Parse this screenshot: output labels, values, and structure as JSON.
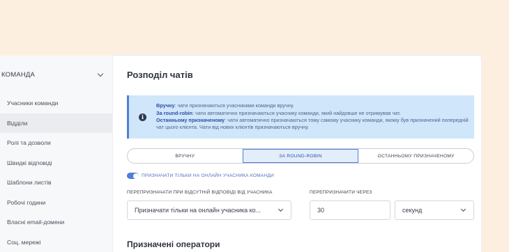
{
  "sidebar": {
    "header": "КОМАНДА",
    "items": [
      {
        "label": "Учасники команди",
        "active": false
      },
      {
        "label": "Відділи",
        "active": true
      },
      {
        "label": "Ролі та дозволи",
        "active": false
      },
      {
        "label": "Швидкі відповіді",
        "active": false
      },
      {
        "label": "Шаблони листів",
        "active": false
      },
      {
        "label": "Робочі години",
        "active": false
      },
      {
        "label": "Власні email-домени",
        "active": false
      },
      {
        "label": "Соц. мережі",
        "active": false
      }
    ]
  },
  "main": {
    "title": "Розподіл чатів",
    "info": {
      "manual_term": "Вручну",
      "manual_text": ": чати призначаються учасниками команди вручну.",
      "robin_term": "За round-robin",
      "robin_text": ": чати автоматично призначаються учаснику команди, який найдовше не отримував чат.",
      "last_term": "Останньому призначеному",
      "last_text": ": чати автоматично призначаються тому самому учаснику команди, якому був призначений попередній чат цього клієнта. Чати від нових клієнтів призначаються вручну."
    },
    "modes": [
      "ВРУЧНУ",
      "ЗА ROUND-ROBIN",
      "ОСТАННЬОМУ ПРИЗНАЧЕНОМУ"
    ],
    "active_mode": 1,
    "toggle_label": "ПРИЗНАЧАТИ ТІЛЬКИ НА ОНЛАЙН УЧАСНИКА КОМАНДИ",
    "toggle_on": true,
    "reassign_label": "ПЕРЕПРИЗНАЧАТИ ПРИ ВІДСУТНІЙ ВІДПОВІДІ ВІД УЧАСНИКА",
    "reassign_value": "Призначати тільки на онлайн учасника ко...",
    "reassign_after_label": "ПЕРЕПРИЗНАЧИТИ ЧЕРЕЗ",
    "reassign_after_value": "30",
    "unit_value": "секунд",
    "operators_title": "Призначені оператори"
  },
  "colors": {
    "background": "#fdefe0",
    "accent": "#4f7fd6",
    "info_bg": "#cfe6fb"
  }
}
